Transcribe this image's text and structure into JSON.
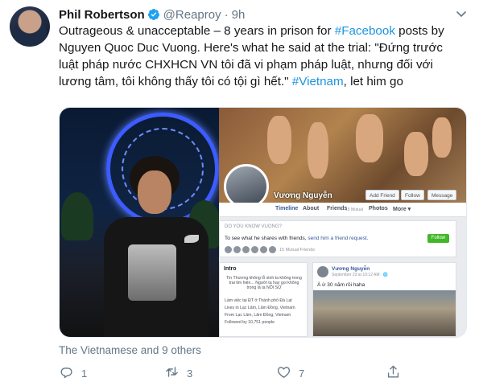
{
  "tweet": {
    "author_name": "Phil Robertson",
    "handle": "@Reaproy",
    "separator": "·",
    "time": "9h",
    "text_parts": [
      {
        "text": "Outrageous & unacceptable – 8 years in prison for ",
        "link": false
      },
      {
        "text": "#Facebook",
        "link": true
      },
      {
        "text": " posts by Nguyen Quoc Duc Vuong. Here's what he said at the trial: \"Đứng trước luật pháp nước CHXHCN VN tôi đã vi phạm pháp luật, nhưng đối với lương tâm, tôi không thấy tôi có tội gì hết.\" ",
        "link": false
      },
      {
        "text": "#Vietnam",
        "link": true
      },
      {
        "text": ", let him go",
        "link": false
      }
    ],
    "liked_by": "The Vietnamese and 9 others",
    "actions": {
      "reply_count": "1",
      "retweet_count": "3",
      "like_count": "7"
    }
  },
  "facebook_screenshot": {
    "profile_name": "Vương Nguyễn",
    "buttons": {
      "add_friend": "Add Friend",
      "follow": "Follow",
      "message": "Message"
    },
    "nav": {
      "timeline": "Timeline",
      "about": "About",
      "friends": "Friends",
      "friends_mutual": "15 Mutual",
      "photos": "Photos",
      "more": "More ▾"
    },
    "know_title": "DO YOU KNOW VUONG?",
    "know_text": "To see what he shares with friends, ",
    "know_link": "send him a friend request.",
    "follow_btn": "Follow",
    "mutual_text": "15 Mutual Friends",
    "intro_title": "Intro",
    "intro_quote": "Tin Thương không lỗ xinh ta không trong trai tim hiện... Người ta hay gọi không trong lá ta NỐI SỢ",
    "intro_lines": [
      "Làm việc tại ĐT ở Thành phố Đà Lạt",
      "Lives in Lạc Lâm, Lâm Đồng, Vietnam",
      "From Lạc Lâm, Lâm Đồng, Vietnam",
      "Followed by 10,751 people"
    ],
    "post_name": "Vương Nguyễn",
    "post_date": "September 23 at 10:12 AM · 🌐",
    "post_text": "À ừ 30 năm rồi haha"
  },
  "colors": {
    "link": "#1b95e0",
    "verified": "#1da1f2",
    "muted": "#657786"
  }
}
